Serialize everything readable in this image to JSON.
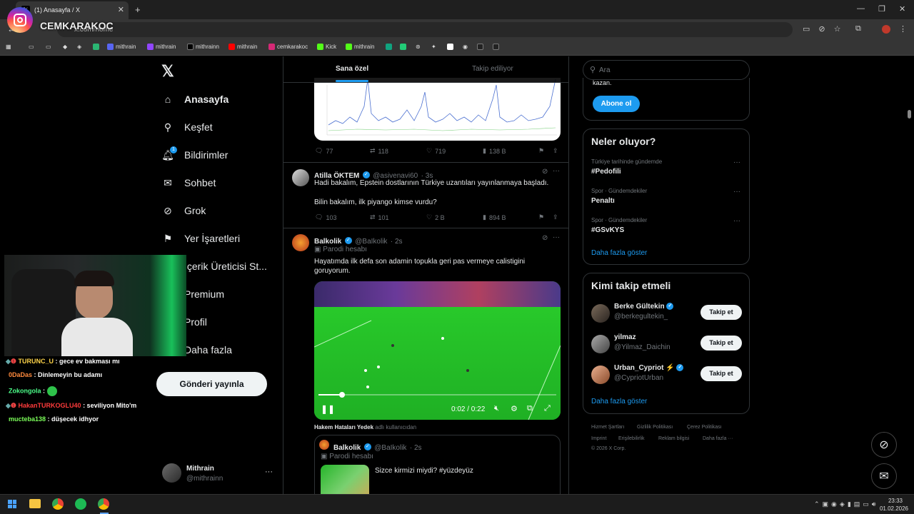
{
  "browser": {
    "tab_title": "(1) Anasayfa / X",
    "url": "x.com/home",
    "bookmarks": [
      "mithrain",
      "mithrain",
      "mithrainn",
      "mithrain",
      "cemkarakoc",
      "Kick",
      "mithrain"
    ]
  },
  "overlay": {
    "channel_name": "CEMKARAKOC",
    "chat": [
      {
        "user": "TURUNC_U",
        "text": ": gece ev bakması mı",
        "color": "#ffd54a"
      },
      {
        "user": "0DaDas",
        "text": ": Dinlemeyin bu adamı",
        "color": "#ff8a3d"
      },
      {
        "user": "Zokongola",
        "text": ":",
        "color": "#4cff8a"
      },
      {
        "user": "HakanTURKOGLU40",
        "text": ": seviliyon Mito'm",
        "color": "#ff3b3b"
      },
      {
        "user": "mucteba138",
        "text": ": düşecek idhyor",
        "color": "#7cff5a"
      }
    ]
  },
  "nav": {
    "items": [
      "Anasayfa",
      "Keşfet",
      "Bildirimler",
      "Sohbet",
      "Grok",
      "Yer İşaretleri",
      "İçerik Üreticisi St...",
      "Premium",
      "Profil",
      "Daha fazla"
    ],
    "notif_badge": "1",
    "post_button": "Gönderi yayınla",
    "account_name": "Mithrain",
    "account_handle": "@mithrainn"
  },
  "feed": {
    "tabs": [
      "Sana özel",
      "Takip ediliyor"
    ],
    "tweet1": {
      "replies": "77",
      "retweets": "118",
      "likes": "719",
      "views": "138 B"
    },
    "tweet2": {
      "name": "Atilla ÖKTEM",
      "handle": "@asivenavi60",
      "time": "· 3s",
      "line1": "Hadi bakalım, Epstein dostlarının Türkiye uzantıları yayınlanmaya başladı.",
      "line2": "Bilin bakalım, ilk piyango kimse vurdu?",
      "replies": "103",
      "retweets": "101",
      "likes": "2 B",
      "views": "894 B"
    },
    "tweet3": {
      "name": "Balkolik",
      "handle": "@BaIkolik",
      "time": "· 2s",
      "label": "Parodi hesabı",
      "text": "Hayatımda ilk defa son adamin topukla geri pas vermeye calistigini goruyorum.",
      "video_time": "0:02 / 0:22",
      "video_progress": 0.1
    },
    "reply_context": {
      "user": "Hakem Hataları Yedek",
      "suffix": "adlı kullanıcıdan"
    },
    "quote": {
      "name": "Balkolik",
      "handle": "@BaIkolik",
      "time": "· 2s",
      "label": "Parodi hesabı",
      "text": "Sizce kirmizi miydi? #yüzdeyüz"
    }
  },
  "sidebar": {
    "search_placeholder": "Ara",
    "subscribe_text": "kazan.",
    "subscribe_button": "Abone ol",
    "trends_title": "Neler oluyor?",
    "trends": [
      {
        "context": "Türkiye tarihinde gündemde",
        "tag": "#Pedofili"
      },
      {
        "context": "Spor · Gündemdekiler",
        "tag": "Penaltı"
      },
      {
        "context": "Spor · Gündemdekiler",
        "tag": "#GSvKYS"
      }
    ],
    "show_more": "Daha fazla göster",
    "who_title": "Kimi takip etmeli",
    "who": [
      {
        "name": "Berke Gültekin",
        "handle": "@berkegultekin_",
        "verified": true
      },
      {
        "name": "yilmaz",
        "handle": "@Yilmaz_Daichin",
        "verified": false
      },
      {
        "name": "Urban_Cypriot ⚡",
        "handle": "@CypriotUrban",
        "verified": true
      }
    ],
    "follow_label": "Takip et",
    "footer": [
      "Hizmet Şartları",
      "Gizlilik Politikası",
      "Çerez Politikası",
      "Imprint",
      "Erişilebilirlik",
      "Reklam bilgisi",
      "Daha fazla ···",
      "© 2026 X Corp."
    ]
  },
  "taskbar": {
    "time": "23:33",
    "date": "01.02.2026"
  },
  "colors": {
    "accent": "#1d9bf0",
    "pitch": "#22c326"
  }
}
